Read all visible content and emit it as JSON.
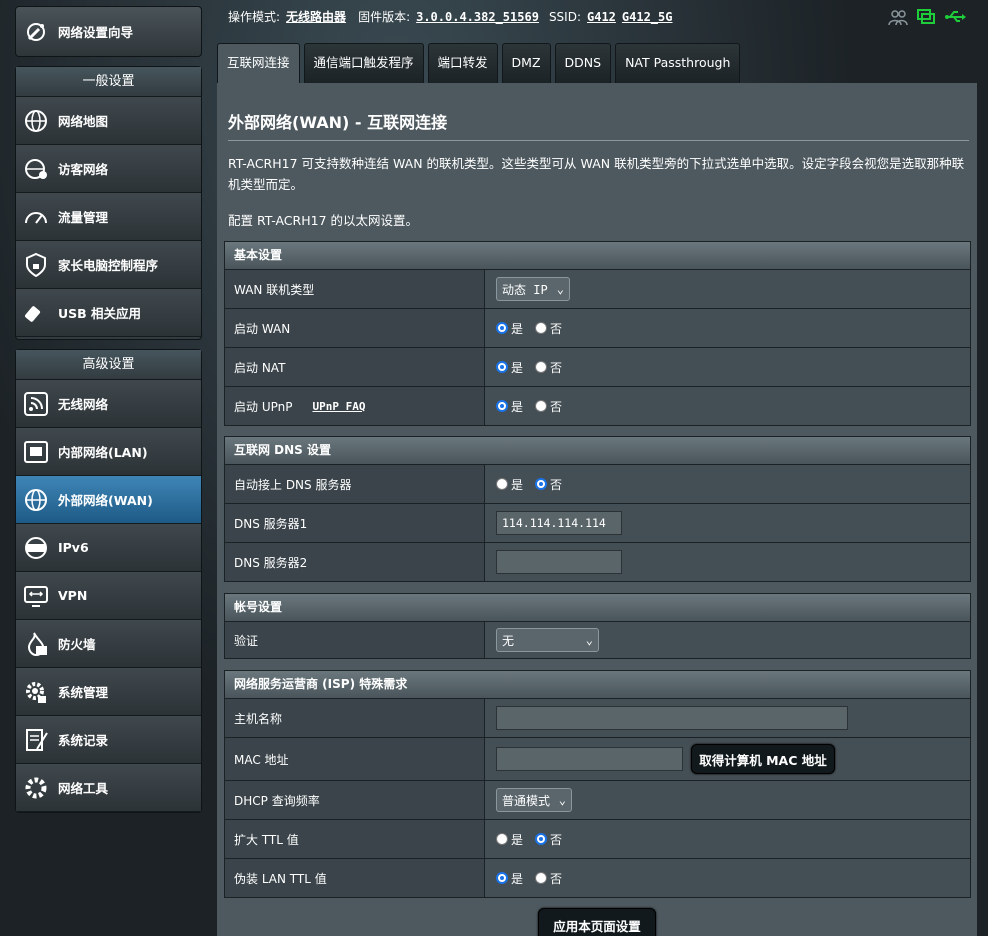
{
  "sidebar": {
    "wizard_label": "网络设置向导",
    "general_title": "一般设置",
    "general_items": [
      {
        "label": "网络地图"
      },
      {
        "label": "访客网络"
      },
      {
        "label": "流量管理"
      },
      {
        "label": "家长电脑控制程序"
      },
      {
        "label": "USB 相关应用"
      }
    ],
    "advanced_title": "高级设置",
    "advanced_items": [
      {
        "label": "无线网络"
      },
      {
        "label": "内部网络(LAN)"
      },
      {
        "label": "外部网络(WAN)"
      },
      {
        "label": "IPv6"
      },
      {
        "label": "VPN"
      },
      {
        "label": "防火墙"
      },
      {
        "label": "系统管理"
      },
      {
        "label": "系统记录"
      },
      {
        "label": "网络工具"
      }
    ]
  },
  "topbar": {
    "mode_label": "操作模式:",
    "mode_value": "无线路由器",
    "firmware_label": "固件版本:",
    "firmware_value": "3.0.0.4.382_51569",
    "ssid_label": "SSID:",
    "ssid_1": "G412",
    "ssid_2": "G412_5G"
  },
  "tabs": [
    "互联网连接",
    "通信端口触发程序",
    "端口转发",
    "DMZ",
    "DDNS",
    "NAT Passthrough"
  ],
  "page": {
    "title": "外部网络(WAN) - 互联网连接",
    "description": "RT-ACRH17 可支持数种连结 WAN 的联机类型。这些类型可从 WAN 联机类型旁的下拉式选单中选取。设定字段会视您是选取那种联机类型而定。",
    "description2": "配置 RT-ACRH17 的以太网设置。"
  },
  "basic": {
    "title": "基本设置",
    "wan_type_label": "WAN 联机类型",
    "wan_type_value": "动态 IP",
    "enable_wan_label": "启动 WAN",
    "enable_nat_label": "启动 NAT",
    "enable_upnp_label": "启动 UPnP",
    "upnp_faq": "UPnP FAQ"
  },
  "radio": {
    "yes": "是",
    "no": "否"
  },
  "dns": {
    "title": "互联网 DNS 设置",
    "auto_label": "自动接上 DNS 服务器",
    "dns1_label": "DNS 服务器1",
    "dns1_value": "114.114.114.114",
    "dns2_label": "DNS 服务器2",
    "dns2_value": ""
  },
  "account": {
    "title": "帐号设置",
    "auth_label": "验证",
    "auth_value": "无"
  },
  "isp": {
    "title": "网络服务运营商 (ISP) 特殊需求",
    "hostname_label": "主机名称",
    "hostname_value": "",
    "mac_label": "MAC 地址",
    "mac_value": "",
    "mac_button": "取得计算机 MAC 地址",
    "dhcp_label": "DHCP 查询频率",
    "dhcp_value": "普通模式",
    "ttl_label": "扩大 TTL 值",
    "spoof_ttl_label": "伪装 LAN TTL 值"
  },
  "apply_button": "应用本页面设置",
  "colors": {
    "accent": "#1a73e8",
    "active_nav": "#2d6f9e",
    "icon_green": "#1fcc3a"
  }
}
